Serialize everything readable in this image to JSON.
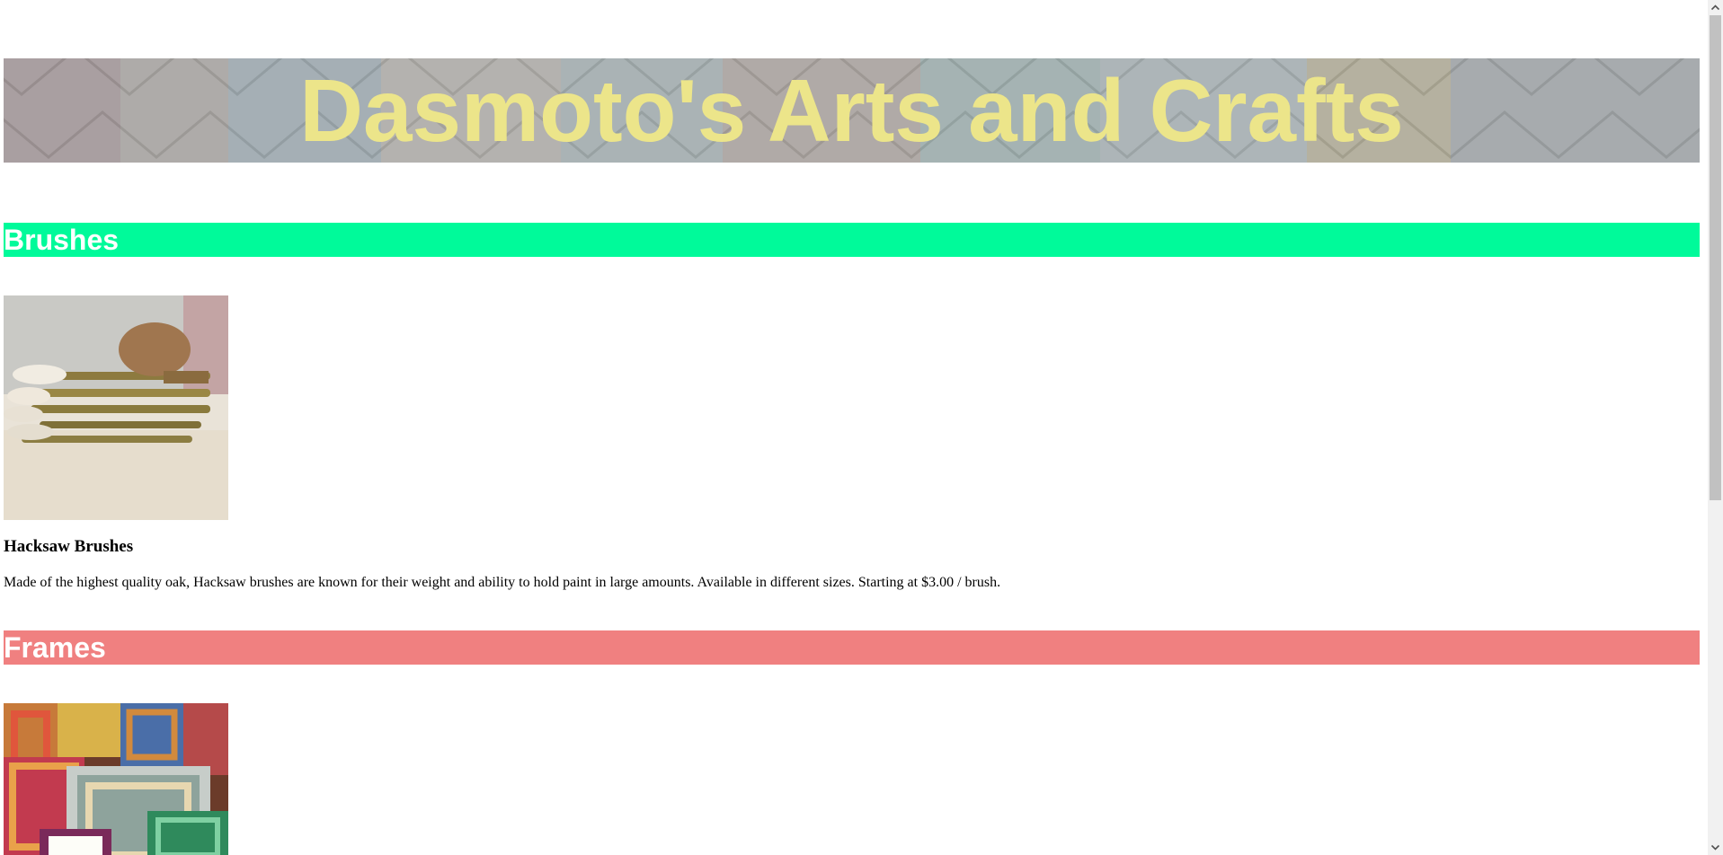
{
  "banner": {
    "title": "Dasmoto's Arts and Crafts",
    "text_color": "#ece58a",
    "background": "colorful roof tiles"
  },
  "sections": [
    {
      "heading": "Brushes",
      "bar_color": "#00fa9a",
      "image": "paint-brushes-photo",
      "product_name": "Hacksaw Brushes",
      "description": "Made of the highest quality oak, Hacksaw brushes are known for their weight and ability to hold paint in large amounts. Available in different sizes. Starting at $3.00 / brush."
    },
    {
      "heading": "Frames",
      "bar_color": "#f08080",
      "image": "picture-frames-photo"
    }
  ],
  "scrollbar": {
    "up_icon": "chevron-up-icon",
    "down_icon": "chevron-down-icon"
  }
}
